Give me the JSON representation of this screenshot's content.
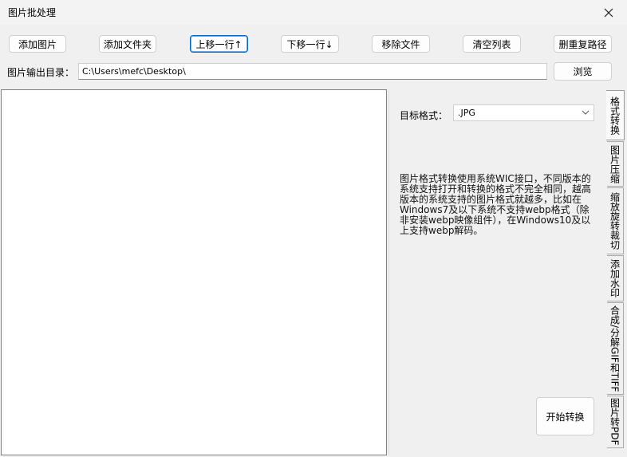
{
  "window": {
    "title": "图片批处理"
  },
  "toolbar": {
    "add_image": "添加图片",
    "add_folder": "添加文件夹",
    "move_up": "上移一行↑",
    "move_down": "下移一行↓",
    "remove_file": "移除文件",
    "clear_list": "清空列表",
    "remove_duplicates": "删重复路径"
  },
  "output": {
    "label": "图片输出目录：",
    "path": "C:\\Users\\mefc\\Desktop\\",
    "browse": "浏览"
  },
  "convert": {
    "format_label": "目标格式：",
    "format_value": ".JPG",
    "description": "图片格式转换使用系统WIC接口，不同版本的系统支持打开和转换的格式不完全相同，越高版本的系统支持的图片格式就越多，比如在Windows7及以下系统不支持webp格式（除非安装webp映像组件），在Windows10及以上支持webp解码。",
    "start_button": "开始转换"
  },
  "tabs": [
    {
      "label": "格式转换"
    },
    {
      "label": "图片压缩"
    },
    {
      "label": "缩放旋转裁切"
    },
    {
      "label": "添加水印"
    },
    {
      "label": "合成/分解GIF和TIFF"
    },
    {
      "label": "图片转PDF"
    }
  ]
}
